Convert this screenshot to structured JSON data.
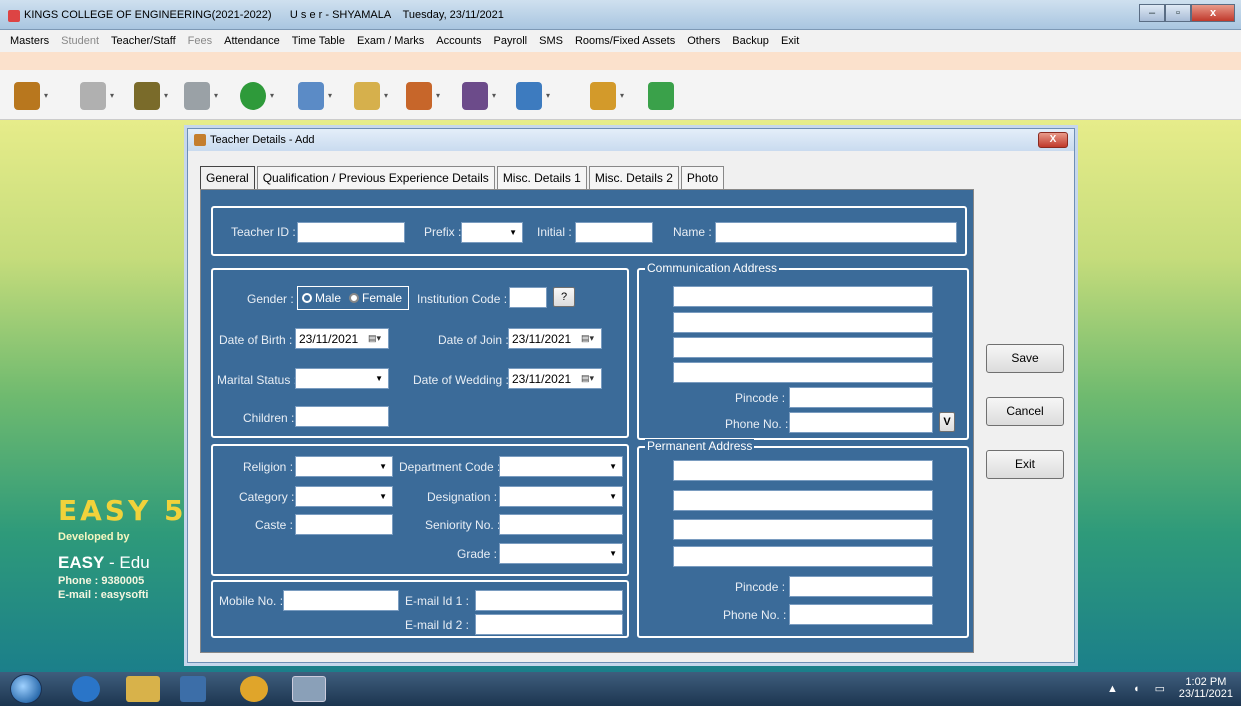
{
  "window": {
    "title": "KINGS COLLEGE OF ENGINEERING(2021-2022)      U s e r - SHYAMALA    Tuesday, 23/11/2021",
    "min": "–",
    "max": "▫",
    "close": "x"
  },
  "menu": [
    {
      "label": "Masters",
      "disabled": false
    },
    {
      "label": "Student",
      "disabled": true
    },
    {
      "label": "Teacher/Staff",
      "disabled": false
    },
    {
      "label": "Fees",
      "disabled": true
    },
    {
      "label": "Attendance",
      "disabled": false
    },
    {
      "label": "Time Table",
      "disabled": false
    },
    {
      "label": "Exam / Marks",
      "disabled": false
    },
    {
      "label": "Accounts",
      "disabled": false
    },
    {
      "label": "Payroll",
      "disabled": false
    },
    {
      "label": "SMS",
      "disabled": false
    },
    {
      "label": "Rooms/Fixed Assets",
      "disabled": false
    },
    {
      "label": "Others",
      "disabled": false
    },
    {
      "label": "Backup",
      "disabled": false
    },
    {
      "label": "Exit",
      "disabled": false
    }
  ],
  "toolbar_icons": [
    "gift-icon",
    "user-icon",
    "group-icon",
    "coins-icon",
    "circle-arrow-icon",
    "calendar-icon",
    "notepad-icon",
    "books-icon",
    "certificate-icon",
    "chart-icon",
    "tools-icon",
    "exit-door-icon"
  ],
  "toolbar_colors": [
    "#b8771e",
    "#b0b0b0",
    "#7a6b2a",
    "#9aa1a6",
    "#2e9a3a",
    "#5b8bc6",
    "#d6b04c",
    "#c7662a",
    "#6c4b8a",
    "#3d7bbf",
    "#d39a2a",
    "#3aa14a"
  ],
  "brand": {
    "big": "EASY 5",
    "developed": "Developed by",
    "easy": "EASY",
    "edu": " - Edu",
    "phone": "Phone : 9380005",
    "email": "E-mail : easysofti"
  },
  "dialog": {
    "title": "Teacher Details - Add",
    "close": "X",
    "tabs": [
      "General",
      "Qualification / Previous Experience Details",
      "Misc. Details 1",
      "Misc. Details 2",
      "Photo"
    ],
    "labels": {
      "teacher_id": "Teacher ID :",
      "prefix": "Prefix :",
      "initial": "Initial :",
      "name": "Name :",
      "gender": "Gender :",
      "male": "Male",
      "female": "Female",
      "institution_code": "Institution Code :",
      "question": "?",
      "dob": "Date of Birth :",
      "doj": "Date of Join :",
      "marital": "Marital Status :",
      "wedding": "Date of Wedding :",
      "children": "Children :",
      "religion": "Religion :",
      "dept_code": "Department Code :",
      "category": "Category :",
      "designation": "Designation :",
      "caste": "Caste :",
      "seniority": "Seniority No. :",
      "grade": "Grade :",
      "mobile": "Mobile No. :",
      "email1": "E-mail Id 1 :",
      "email2": "E-mail Id 2 :",
      "comm_address": "Communication Address",
      "perm_address": "Permanent Address",
      "pincode": "Pincode :",
      "phone": "Phone No. :",
      "v": "V"
    },
    "values": {
      "dob": "23/11/2021",
      "doj": "23/11/2021",
      "wedding": "23/11/2021"
    },
    "buttons": {
      "save": "Save",
      "cancel": "Cancel",
      "exit": "Exit"
    }
  },
  "taskbar": {
    "time": "1:02 PM",
    "date": "23/11/2021",
    "tray": "▲ ◖ ▭"
  }
}
